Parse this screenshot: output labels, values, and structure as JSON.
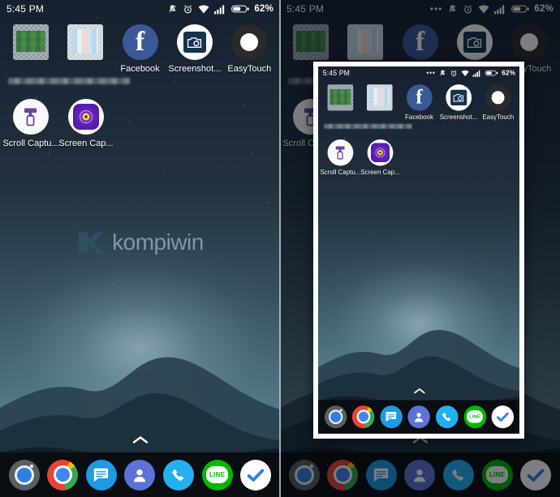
{
  "meta": {
    "description": "Android home screen screenshot tutorial, two panels side by side",
    "watermark_text": "kompiwin",
    "watermark_color": "#9fb9cc"
  },
  "status_bar": {
    "time": "5:45 PM",
    "battery_percent": "62%",
    "overflow_dots": "•••",
    "icons": [
      "vibrate-off-icon",
      "alarm-icon",
      "wifi-icon",
      "signal-icon",
      "battery-icon"
    ]
  },
  "home_screen": {
    "rows": [
      {
        "apps": [
          {
            "label": "",
            "icon": "censored-green-app-icon",
            "censored": true
          },
          {
            "label": "",
            "icon": "censored-blue-app-icon",
            "censored": true
          },
          {
            "label": "Facebook",
            "icon": "facebook-icon",
            "color": "#3b5998"
          },
          {
            "label": "Screenshot...",
            "icon": "screenshot-app-icon",
            "color": "#16324d"
          },
          {
            "label": "EasyTouch",
            "icon": "easytouch-icon",
            "color": "#2a2a2a"
          }
        ]
      },
      {
        "apps": [
          {
            "label": "Scroll Captu...",
            "icon": "scroll-capture-icon",
            "color": "#6b3fa0"
          },
          {
            "label": "Screen Cap...",
            "icon": "screen-capture-icon",
            "color": "#5c1fb5"
          }
        ]
      }
    ]
  },
  "dock": {
    "items": [
      {
        "label": "Camera",
        "icon": "camera-icon"
      },
      {
        "label": "Chrome",
        "icon": "chrome-icon"
      },
      {
        "label": "Messages",
        "icon": "messages-icon"
      },
      {
        "label": "Contacts",
        "icon": "contacts-icon"
      },
      {
        "label": "Phone",
        "icon": "phone-icon"
      },
      {
        "label": "LINE",
        "icon": "line-icon",
        "glyph": "LINE"
      },
      {
        "label": "Tasks",
        "icon": "checkmark-icon"
      }
    ],
    "app_drawer_handle": "chevron-up-icon"
  },
  "right_panel": {
    "overlay_dimmed": true,
    "popup": {
      "name": "screenshot-preview-popup",
      "border_color": "#ffffff"
    }
  }
}
